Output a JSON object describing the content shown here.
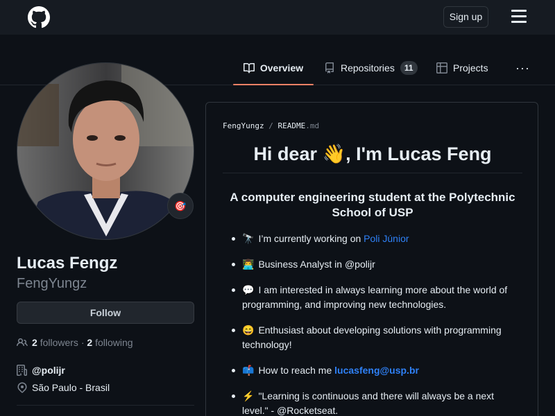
{
  "header": {
    "signup_label": "Sign up"
  },
  "tabs": [
    {
      "label": "Overview",
      "icon": "book-icon",
      "selected": true
    },
    {
      "label": "Repositories",
      "icon": "repo-icon",
      "count": "11"
    },
    {
      "label": "Projects",
      "icon": "table-icon"
    }
  ],
  "profile": {
    "name": "Lucas Fengz",
    "login": "FengYungz",
    "follow_label": "Follow",
    "followers_count": "2",
    "followers_label": "followers",
    "separator": "·",
    "following_count": "2",
    "following_label": "following",
    "organization": "@polijr",
    "location": "São Paulo - Brasil",
    "status_emoji": "🎯"
  },
  "readme": {
    "path_owner": "FengYungz",
    "path_sep": "/",
    "path_file": "README",
    "path_ext": ".md",
    "title": "Hi dear 👋, I'm Lucas Feng",
    "subtitle": "A computer engineering student at the Polytechnic School of USP",
    "items": [
      {
        "emoji": "🔭",
        "text": "I’m currently working on ",
        "link": "Poli Júnior"
      },
      {
        "emoji": "👨‍💻",
        "text": "Business Analyst in @polijr"
      },
      {
        "emoji": "💬",
        "text": "I am interested in always learning more about the world of programming, and improving new technologies."
      },
      {
        "emoji": "😄",
        "text": "Enthusiast about developing solutions with programming technology!"
      },
      {
        "emoji": "📫",
        "text": "How to reach me ",
        "link": "lucasfeng@usp.br"
      },
      {
        "emoji": "⚡",
        "text": "\"Learning is continuous and there will always be a next level.\" - @Rocketseat."
      }
    ]
  },
  "colors": {
    "background": "#0d1117",
    "header": "#161b22",
    "accent_underline": "#f78166",
    "link": "#2f81f7",
    "muted_text": "#7d8590",
    "border": "#30363d"
  }
}
